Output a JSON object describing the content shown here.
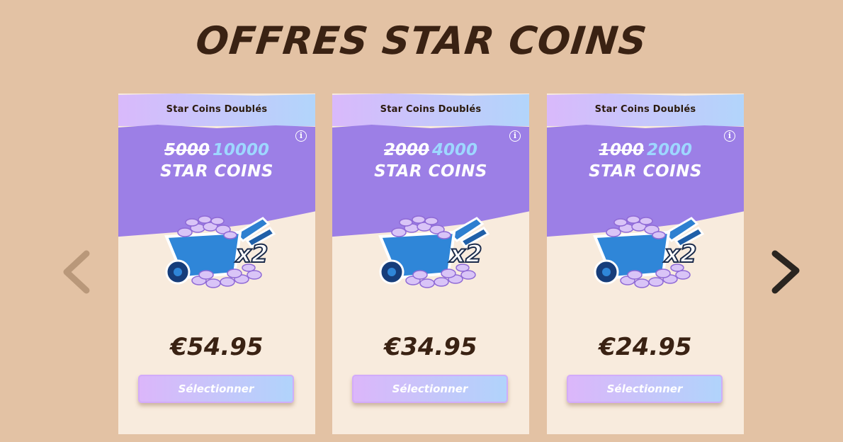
{
  "page": {
    "title": "OFFRES STAR COINS"
  },
  "nav": {
    "prev_icon": "chevron-left-icon",
    "next_icon": "chevron-right-icon"
  },
  "colors": {
    "background": "#e3c2a4",
    "card": "#f8ebdd",
    "band": "#9c7fe6",
    "header_gradient": [
      "#d9b9fb",
      "#b2d5fb"
    ],
    "new_amount": "#9ed7ff",
    "text_dark": "#3a2213"
  },
  "offers": [
    {
      "header": "Star Coins Doublés",
      "old_amount": "5000",
      "new_amount": "10000",
      "unit": "STAR COINS",
      "multiplier": "x2",
      "price": "€54.95",
      "button": "Sélectionner",
      "info_icon": "info-icon"
    },
    {
      "header": "Star Coins Doublés",
      "old_amount": "2000",
      "new_amount": "4000",
      "unit": "STAR COINS",
      "multiplier": "x2",
      "price": "€34.95",
      "button": "Sélectionner",
      "info_icon": "info-icon"
    },
    {
      "header": "Star Coins Doublés",
      "old_amount": "1000",
      "new_amount": "2000",
      "unit": "STAR COINS",
      "multiplier": "x2",
      "price": "€24.95",
      "button": "Sélectionner",
      "info_icon": "info-icon"
    }
  ]
}
